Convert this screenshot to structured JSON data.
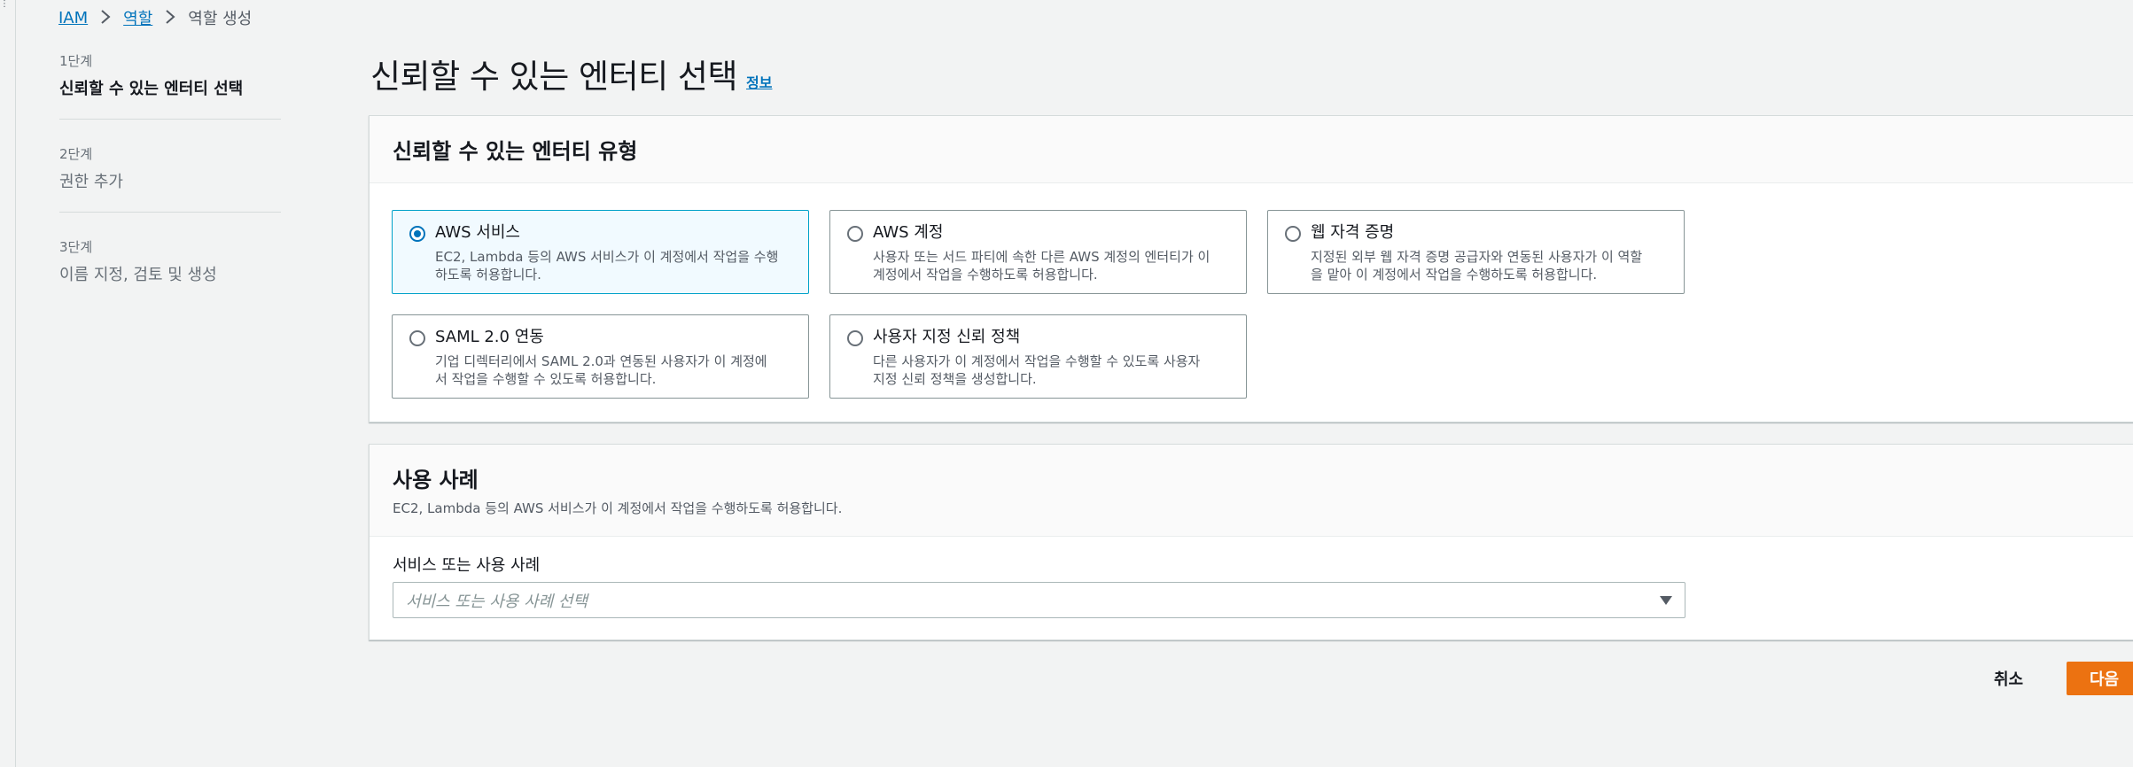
{
  "breadcrumb": {
    "items": [
      "IAM",
      "역할"
    ],
    "current": "역할 생성"
  },
  "steps": [
    {
      "num": "1단계",
      "title": "신뢰할 수 있는 엔터티 선택",
      "active": true
    },
    {
      "num": "2단계",
      "title": "권한 추가",
      "active": false
    },
    {
      "num": "3단계",
      "title": "이름 지정, 검토 및 생성",
      "active": false
    }
  ],
  "page": {
    "title": "신뢰할 수 있는 엔터티 선택",
    "info": "정보"
  },
  "entity_types": {
    "header": "신뢰할 수 있는 엔터티 유형",
    "options": [
      {
        "title": "AWS 서비스",
        "desc1": "EC2, Lambda 등의 AWS 서비스가 이 계정에서 작업을 수행",
        "desc2": "하도록 허용합니다.",
        "selected": true
      },
      {
        "title": "AWS 계정",
        "desc1": "사용자 또는 서드 파티에 속한 다른 AWS 계정의 엔터티가 이",
        "desc2": "계정에서 작업을 수행하도록 허용합니다.",
        "selected": false
      },
      {
        "title": "웹 자격 증명",
        "desc1": "지정된 외부 웹 자격 증명 공급자와 연동된 사용자가 이 역할",
        "desc2": "을 맡아 이 계정에서 작업을 수행하도록 허용합니다.",
        "selected": false
      },
      {
        "title": "SAML 2.0 연동",
        "desc1": "기업 디렉터리에서 SAML 2.0과 연동된 사용자가 이 계정에",
        "desc2": "서 작업을 수행할 수 있도록 허용합니다.",
        "selected": false
      },
      {
        "title": "사용자 지정 신뢰 정책",
        "desc1": "다른 사용자가 이 계정에서 작업을 수행할 수 있도록 사용자",
        "desc2": "지정 신뢰 정책을 생성합니다.",
        "selected": false
      }
    ]
  },
  "use_case": {
    "header": "사용 사례",
    "description": "EC2, Lambda 등의 AWS 서비스가 이 계정에서 작업을 수행하도록 허용합니다.",
    "field_label": "서비스 또는 사용 사례",
    "placeholder": "서비스 또는 사용 사례 선택"
  },
  "actions": {
    "cancel": "취소",
    "next": "다음"
  },
  "colors": {
    "accent": "#0073bb",
    "primary_button": "#ec7211",
    "selected_tile_border": "#00a1c9"
  }
}
